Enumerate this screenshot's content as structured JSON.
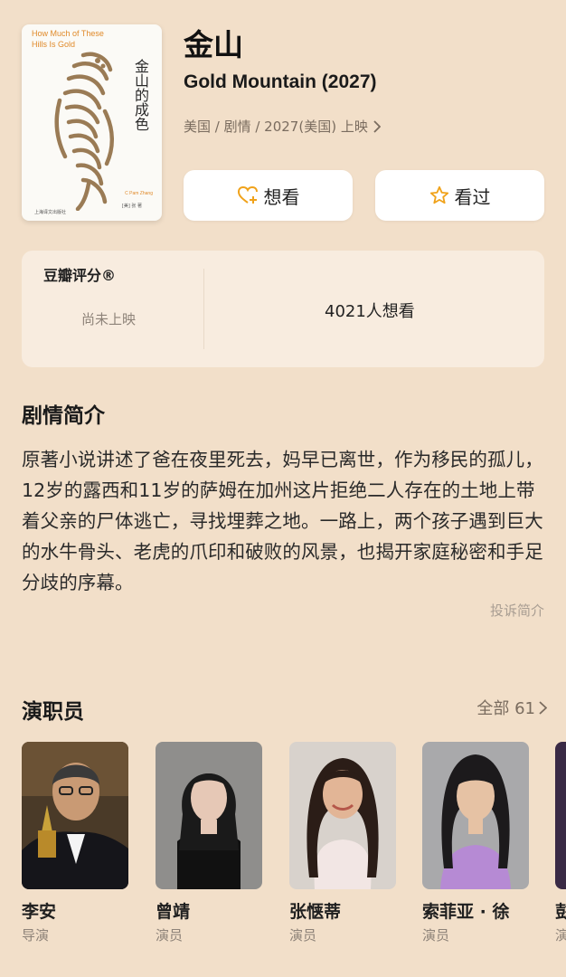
{
  "movie": {
    "title_cn": "金山",
    "title_en": "Gold Mountain (2027)",
    "meta": "美国 / 剧情 / 2027(美国) 上映"
  },
  "poster": {
    "en_title": "How Much of These Hills Is Gold",
    "cn_title": "金山的成色",
    "author": "C Pam Zhang",
    "translator": "[美] 张 著",
    "publisher": "上海译文出版社"
  },
  "actions": {
    "want": "想看",
    "seen": "看过"
  },
  "rating": {
    "title": "豆瓣评分®",
    "status": "尚未上映",
    "want_count": "4021人想看"
  },
  "synopsis": {
    "title": "剧情简介",
    "text": "原著小说讲述了爸在夜里死去，妈早已离世，作为移民的孤儿，12岁的露西和11岁的萨姆在加州这片拒绝二人存在的土地上带着父亲的尸体逃亡，寻找埋葬之地。一路上，两个孩子遇到巨大的水牛骨头、老虎的爪印和破败的风景，也揭开家庭秘密和手足分歧的序幕。",
    "report": "投诉简介"
  },
  "cast": {
    "title": "演职员",
    "all_label": "全部 61",
    "members": [
      {
        "name": "李安",
        "role": "导演"
      },
      {
        "name": "曾靖",
        "role": "演员"
      },
      {
        "name": "张惬蒂",
        "role": "演员"
      },
      {
        "name": "索菲亚 · 徐",
        "role": "演员"
      },
      {
        "name": "彭",
        "role": "演"
      }
    ]
  },
  "colors": {
    "background": "#f2dfc9",
    "accent": "#f0a21a",
    "card": "#ffffff"
  }
}
